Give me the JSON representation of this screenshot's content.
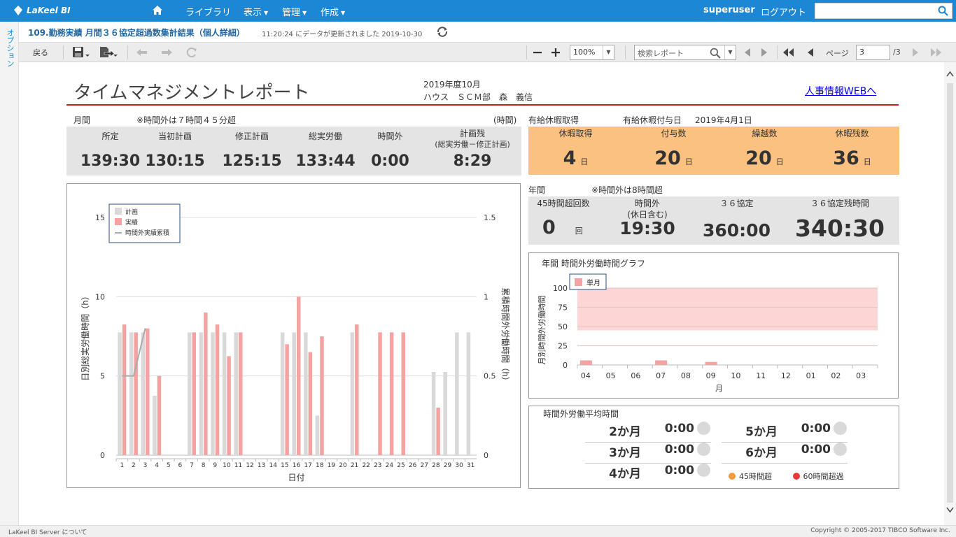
{
  "app": {
    "brand": "LaKeel BI",
    "menus": [
      "ライブラリ",
      "表示",
      "管理",
      "作成"
    ],
    "user": "superuser",
    "logout": "ログアウト",
    "side_tab": "オプション"
  },
  "title_bar": {
    "title": "109.勤務実績 月間３６協定超過数集計結果（個人詳細）",
    "updated": "11:20:24 にデータが更新されました 2019-10-30"
  },
  "toolbar": {
    "back": "戻る",
    "zoom": "100%",
    "search_placeholder": "検索レポート",
    "page_label": "ページ",
    "page": "3",
    "page_total": "/3"
  },
  "report": {
    "title": "タイムマネジメントレポート",
    "period": "2019年度10月",
    "person": "ハウス　ＳＣＭ部　森　義信",
    "link": "人事情報WEBへ",
    "monthly": {
      "label": "月間",
      "note": "※時間外は７時間４５分超",
      "unit": "(時間)",
      "columns": [
        {
          "h": "所定",
          "v": "139:30"
        },
        {
          "h": "当初計画",
          "v": "130:15"
        },
        {
          "h": "修正計画",
          "v": "125:15"
        },
        {
          "h": "総実労働",
          "v": "133:44"
        },
        {
          "h": "時間外",
          "v": "0:00"
        },
        {
          "h": "計画残",
          "h2": "(総実労働－修正計画)",
          "v": "8:29"
        }
      ]
    },
    "leave": {
      "label": "有給休暇取得",
      "grant_label": "有給休暇付与日",
      "grant_date": "2019年4月1日",
      "unit": "日",
      "columns": [
        {
          "h": "休暇取得",
          "v": "4"
        },
        {
          "h": "付与数",
          "v": "20"
        },
        {
          "h": "繰越数",
          "v": "20"
        },
        {
          "h": "休暇残数",
          "v": "36"
        }
      ]
    },
    "annual": {
      "label": "年間",
      "note": "※時間外は8時間超",
      "c1": {
        "h": "45時間超回数",
        "v": "0",
        "u": "回"
      },
      "c2": {
        "h": "時間外",
        "h2": "(休日含む)",
        "v": "19:30"
      },
      "c3": {
        "h": "３６協定",
        "v": "360:00"
      },
      "c4": {
        "h": "３６協定残時間",
        "v": "340:30"
      }
    },
    "average": {
      "title": "時間外労働平均時間",
      "rows": [
        {
          "k": "2か月",
          "v": "0:00"
        },
        {
          "k": "3か月",
          "v": "0:00"
        },
        {
          "k": "4か月",
          "v": "0:00"
        },
        {
          "k": "5か月",
          "v": "0:00"
        },
        {
          "k": "6か月",
          "v": "0:00"
        }
      ],
      "legend": [
        {
          "label": "45時間超",
          "color": "#f39a3c"
        },
        {
          "label": "60時間超過",
          "color": "#e8393a"
        }
      ]
    }
  },
  "chart_data": [
    {
      "type": "bar",
      "xlabel": "日付",
      "ylabel": "日別総実労働時間（h）",
      "y2label": "累積時間外労働時間（h）",
      "ylim": [
        0,
        15
      ],
      "y2lim": [
        0,
        1.5
      ],
      "yticks": [
        0,
        5,
        10,
        15
      ],
      "y2ticks": [
        "0",
        "0.5",
        "1",
        "1.5"
      ],
      "legend_position": "top-left",
      "categories": [
        "1",
        "2",
        "3",
        "4",
        "5",
        "6",
        "7",
        "8",
        "9",
        "10",
        "11",
        "12",
        "13",
        "14",
        "15",
        "16",
        "17",
        "18",
        "19",
        "20",
        "21",
        "22",
        "23",
        "24",
        "25",
        "26",
        "27",
        "28",
        "29",
        "30",
        "31"
      ],
      "series": [
        {
          "name": "計画",
          "color": "#d9d9d9",
          "values": [
            7.75,
            7.75,
            7.75,
            3.75,
            0,
            0,
            7.75,
            7.75,
            7.75,
            7.75,
            7.75,
            0,
            0,
            0,
            7.75,
            7.75,
            7.75,
            2.5,
            0,
            0,
            7.75,
            0,
            0,
            0,
            0,
            0,
            0,
            5.25,
            5.25,
            7.75,
            7.75
          ]
        },
        {
          "name": "実績",
          "color": "#f4a3a3",
          "values": [
            8.25,
            7.75,
            8,
            5,
            0,
            0,
            7.75,
            9,
            8.25,
            6.25,
            7.75,
            0,
            0,
            0,
            7,
            10,
            6.5,
            7.5,
            0,
            0,
            8.25,
            0,
            7.75,
            7.75,
            7.75,
            0,
            0,
            3,
            0,
            0,
            0
          ]
        },
        {
          "name": "時間外実績累積",
          "color": "#aaaaaa",
          "type": "line",
          "points": [
            [
              1,
              0.5
            ],
            [
              2,
              0.5
            ],
            [
              3,
              0.8
            ]
          ]
        }
      ]
    },
    {
      "type": "bar",
      "title": "年間 時間外労働時間グラフ",
      "xlabel": "月",
      "ylabel": "月別時間外労働時間",
      "ylim": [
        0,
        100
      ],
      "yticks": [
        0,
        25,
        50,
        75,
        100
      ],
      "band": [
        45,
        100
      ],
      "legend_position": "top-left",
      "categories": [
        "04",
        "05",
        "06",
        "07",
        "08",
        "09",
        "10",
        "11",
        "12",
        "01",
        "02",
        "03"
      ],
      "series": [
        {
          "name": "単月",
          "color": "#f4a3a3",
          "values": [
            6,
            0,
            0,
            6,
            0,
            4,
            0,
            0,
            0,
            0,
            0,
            0
          ]
        }
      ]
    }
  ]
}
